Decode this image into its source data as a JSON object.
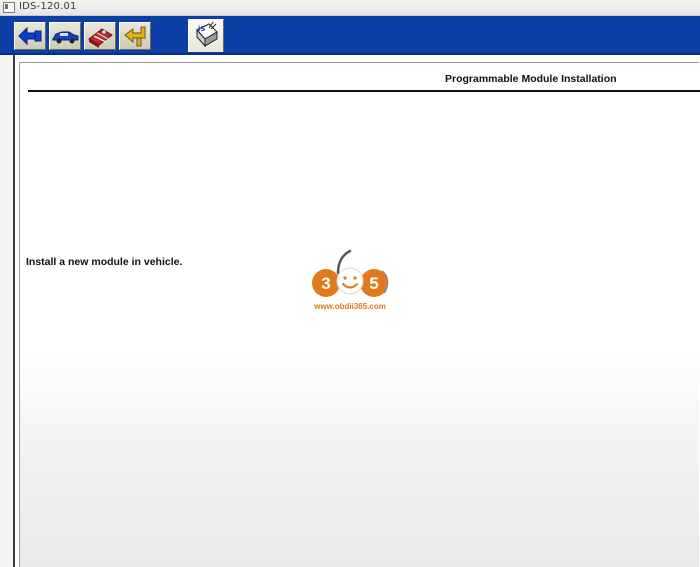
{
  "window": {
    "title": "IDS-120.01"
  },
  "toolbar": {
    "buttons": [
      {
        "name": "connect-icon"
      },
      {
        "name": "vehicle-icon"
      },
      {
        "name": "toolbox-icon"
      },
      {
        "name": "back-arrow-icon"
      },
      {
        "name": "module-programming-icon",
        "active": true
      }
    ]
  },
  "page": {
    "title": "Programmable Module Installation",
    "instruction": "Install a new module in vehicle."
  },
  "watermark": {
    "logo_text": "365",
    "url": "www.obdii365.com"
  },
  "colors": {
    "toolbar_bg": "#0b3fa6",
    "watermark_orange": "#e07a1d"
  }
}
